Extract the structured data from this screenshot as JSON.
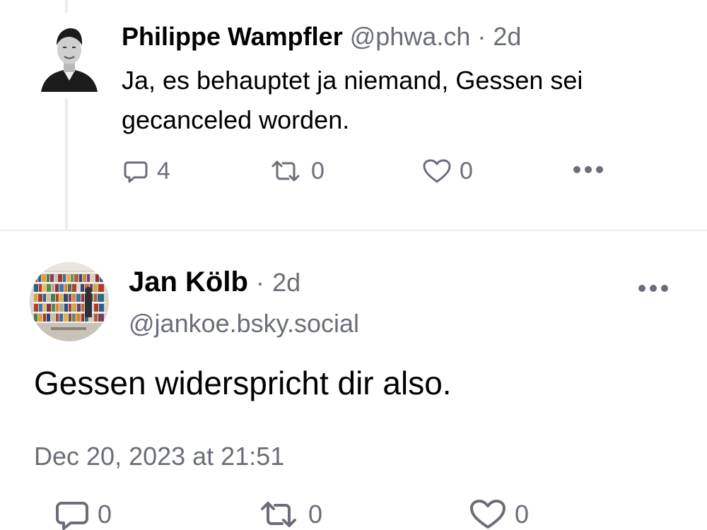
{
  "reply_post": {
    "author_name": "Philippe Wampfler",
    "handle": "@phwa.ch",
    "separator": "·",
    "age": "2d",
    "text": "Ja, es behauptet ja niemand, Gessen sei gecanceled worden.",
    "reply_count": "4",
    "repost_count": "0",
    "like_count": "0",
    "reply_icon": "comment-icon",
    "repost_icon": "repost-icon",
    "like_icon": "heart-icon",
    "more_icon": "more-dots-icon"
  },
  "main_post": {
    "author_name": "Jan Kölb",
    "separator": "·",
    "age": "2d",
    "handle": "@jankoe.bsky.social",
    "text": "Gessen widerspricht dir also.",
    "timestamp": "Dec 20, 2023 at 21:51",
    "reply_count": "0",
    "repost_count": "0",
    "like_count": "0",
    "more_icon": "more-dots-icon"
  },
  "colors": {
    "muted": "#6b6e7a",
    "divider": "#eeeaf0",
    "text": "#000000"
  }
}
